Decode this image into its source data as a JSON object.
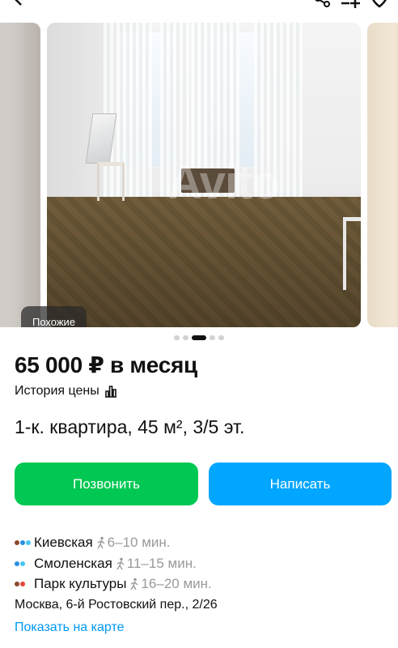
{
  "gallery": {
    "similar_label": "Похожие",
    "watermark": "Avito",
    "dots_total": 5,
    "active_dot": 2
  },
  "listing": {
    "price": "65 000 ₽ в месяц",
    "price_history_label": "История цены",
    "title": "1-к. квартира, 45 м², 3/5 эт."
  },
  "actions": {
    "call_label": "Позвонить",
    "message_label": "Написать"
  },
  "metro": [
    {
      "name": "Киевская",
      "time": "6–10 мин.",
      "colors": [
        "#8b4a2e",
        "#2a8fe0",
        "#47c6f2"
      ]
    },
    {
      "name": "Смоленская",
      "time": "11–15 мин.",
      "colors": [
        "#2a8fe0",
        "#47c6f2"
      ]
    },
    {
      "name": "Парк культуры",
      "time": "16–20 мин.",
      "colors": [
        "#8b4a2e",
        "#e8423a"
      ]
    }
  ],
  "address": "Москва, 6-й Ростовский пер., 2/26",
  "map_link": "Показать на карте",
  "colors": {
    "call_button": "#00c853",
    "message_button": "#00a6ff",
    "link": "#0099f7"
  }
}
